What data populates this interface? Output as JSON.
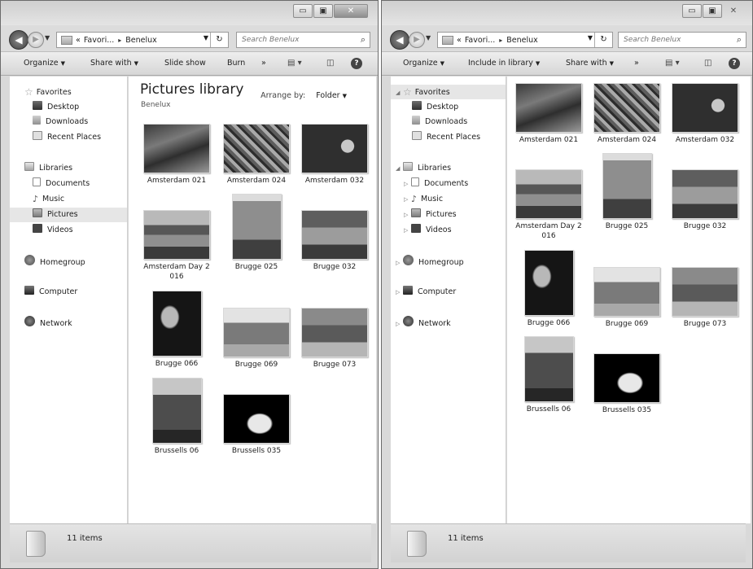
{
  "left_window": {
    "controls": {
      "minimize": "▭",
      "maximize": "▣",
      "close": "✕"
    },
    "address": {
      "prefix": "«",
      "crumb1": "Favori...",
      "sep": "▸",
      "crumb2": "Benelux"
    },
    "search_placeholder": "Search Benelux",
    "toolbar": {
      "organize": "Organize",
      "share_with": "Share with",
      "slide_show": "Slide show",
      "burn": "Burn",
      "more": "»"
    },
    "nav": {
      "favorites": "Favorites",
      "desktop": "Desktop",
      "downloads": "Downloads",
      "recent_places": "Recent Places",
      "libraries": "Libraries",
      "documents": "Documents",
      "music": "Music",
      "pictures": "Pictures",
      "videos": "Videos",
      "homegroup": "Homegroup",
      "computer": "Computer",
      "network": "Network"
    },
    "library_title": "Pictures library",
    "library_subtitle": "Benelux",
    "arrange_label": "Arrange by:",
    "arrange_value": "Folder",
    "files": [
      "Amsterdam 021",
      "Amsterdam 024",
      "Amsterdam 032",
      "Amsterdam Day 2 016",
      "Brugge 025",
      "Brugge 032",
      "Brugge 066",
      "Brugge 069",
      "Brugge 073",
      "Brussells 06",
      "Brussells 035"
    ],
    "status": "11 items"
  },
  "right_window": {
    "controls": {
      "minimize": "▭",
      "maximize": "▣",
      "close": "✕"
    },
    "address": {
      "prefix": "«",
      "crumb1": "Favori...",
      "sep": "▸",
      "crumb2": "Benelux"
    },
    "search_placeholder": "Search Benelux",
    "toolbar": {
      "organize": "Organize",
      "include_in_library": "Include in library",
      "share_with": "Share with",
      "more": "»"
    },
    "nav": {
      "favorites": "Favorites",
      "desktop": "Desktop",
      "downloads": "Downloads",
      "recent_places": "Recent Places",
      "libraries": "Libraries",
      "documents": "Documents",
      "music": "Music",
      "pictures": "Pictures",
      "videos": "Videos",
      "homegroup": "Homegroup",
      "computer": "Computer",
      "network": "Network"
    },
    "files": [
      "Amsterdam 021",
      "Amsterdam 024",
      "Amsterdam 032",
      "Amsterdam Day 2 016",
      "Brugge 025",
      "Brugge 032",
      "Brugge 066",
      "Brugge 069",
      "Brugge 073",
      "Brussells 06",
      "Brussells 035"
    ],
    "status": "11 items"
  }
}
